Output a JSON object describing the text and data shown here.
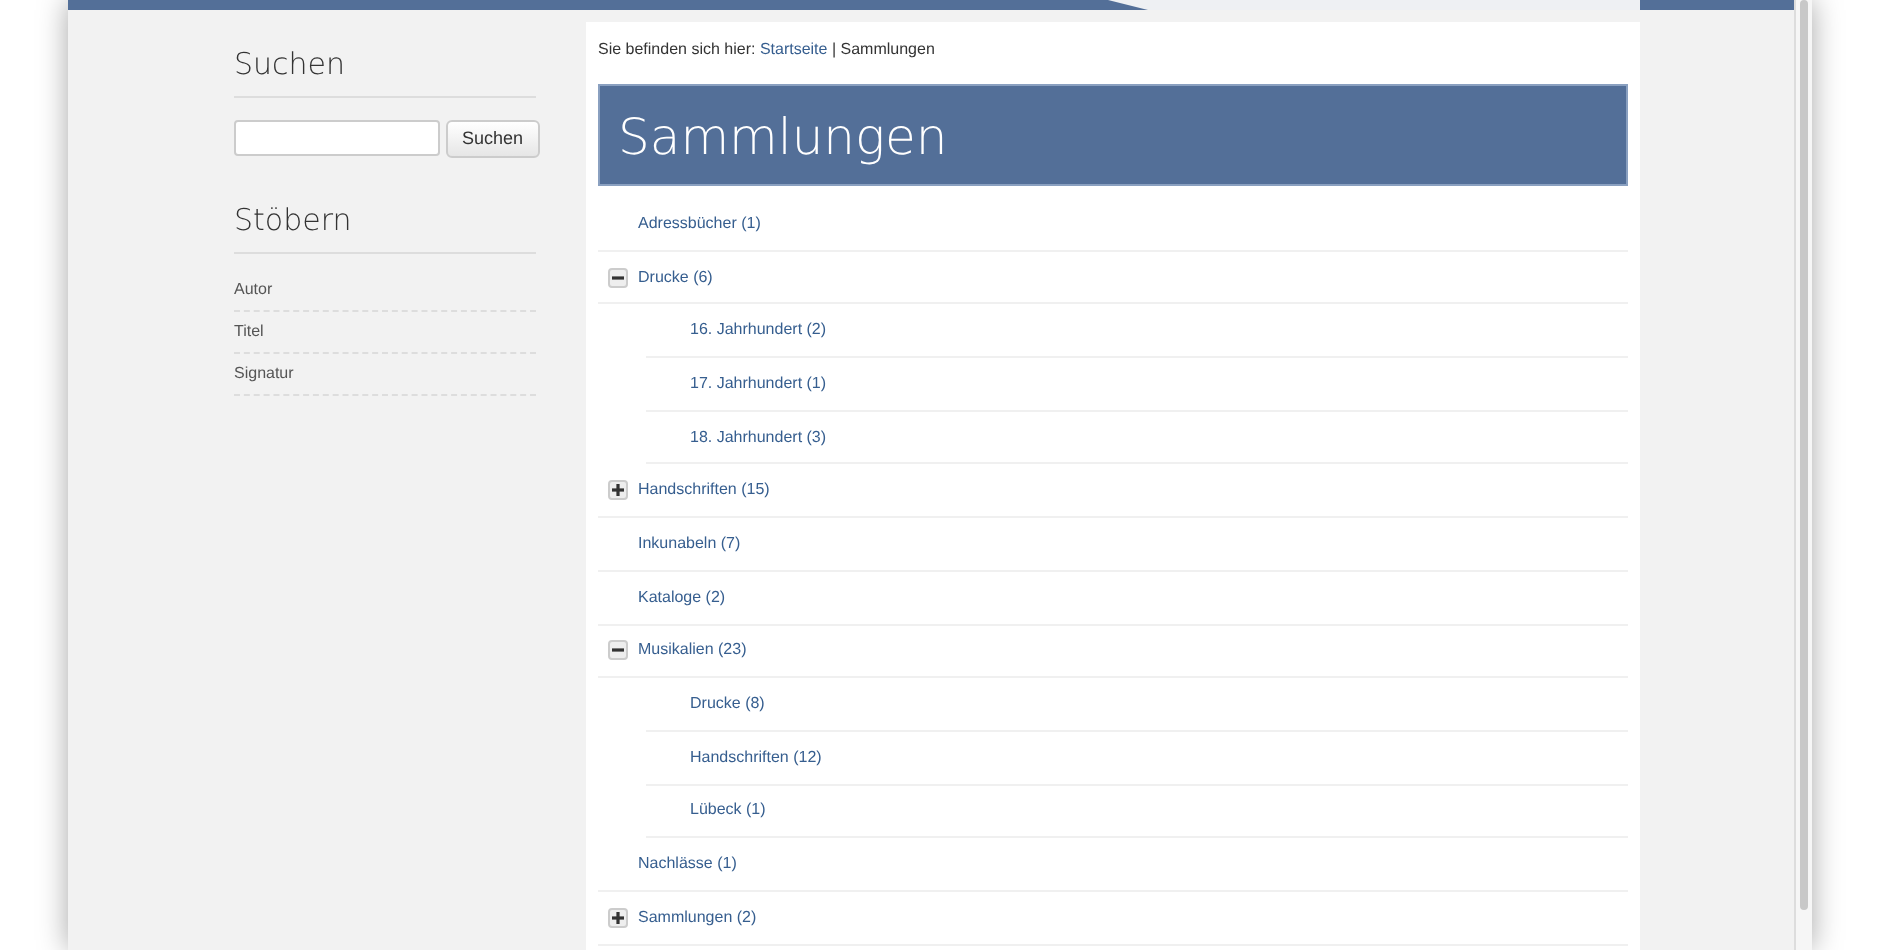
{
  "sidebar": {
    "search": {
      "heading": "Suchen",
      "button": "Suchen"
    },
    "browse": {
      "heading": "Stöbern",
      "items": [
        "Autor",
        "Titel",
        "Signatur"
      ]
    }
  },
  "breadcrumb": {
    "prefix": "Sie befinden sich hier:",
    "links": [
      "Startseite"
    ],
    "separator": "|",
    "current": "Sammlungen"
  },
  "page_title": "Sammlungen",
  "tree": [
    {
      "label": "Adressbücher (1)",
      "kind": "leaf"
    },
    {
      "label": "Drucke (6)",
      "kind": "branch",
      "expanded": true,
      "children": [
        {
          "label": "16. Jahrhundert (2)"
        },
        {
          "label": "17. Jahrhundert (1)"
        },
        {
          "label": "18. Jahrhundert (3)"
        }
      ]
    },
    {
      "label": "Handschriften (15)",
      "kind": "branch",
      "expanded": false
    },
    {
      "label": "Inkunabeln (7)",
      "kind": "leaf"
    },
    {
      "label": "Kataloge (2)",
      "kind": "leaf"
    },
    {
      "label": "Musikalien (23)",
      "kind": "branch",
      "expanded": true,
      "children": [
        {
          "label": "Drucke (8)"
        },
        {
          "label": "Handschriften (12)"
        },
        {
          "label": "Lübeck (1)"
        }
      ]
    },
    {
      "label": "Nachlässe (1)",
      "kind": "leaf"
    },
    {
      "label": "Sammlungen (2)",
      "kind": "branch",
      "expanded": false
    }
  ]
}
